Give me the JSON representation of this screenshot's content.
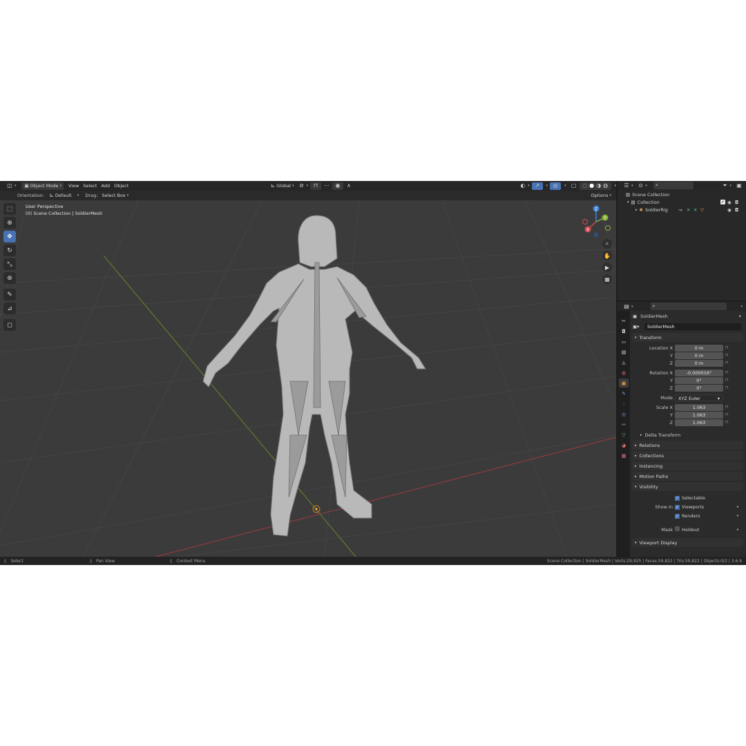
{
  "header": {
    "mode": "Object Mode",
    "menus": [
      "View",
      "Select",
      "Add",
      "Object"
    ],
    "transform_orientation": "Global"
  },
  "toolbar2": {
    "orientation_label": "Orientation:",
    "orientation_value": "Default",
    "drag_label": "Drag:",
    "drag_value": "Select Box",
    "options_label": "Options"
  },
  "viewport": {
    "perspective": "User Perspective",
    "context": "(0) Scene Collection | SoldierMesh",
    "gizmo_axes": [
      "Z",
      "Y",
      "X"
    ],
    "axis_colors": {
      "x": "#d34b53",
      "y": "#8bb33a",
      "z": "#3f86d6"
    }
  },
  "tools": [
    "select-box",
    "cursor",
    "move",
    "rotate",
    "scale",
    "transform",
    "annotate",
    "measure",
    "add-cube"
  ],
  "outliner": {
    "search_placeholder": "",
    "items": [
      {
        "label": "Scene Collection"
      },
      {
        "label": "Collection"
      },
      {
        "label": "SoldierRig"
      }
    ]
  },
  "properties": {
    "search_placeholder": "",
    "object_name": "SoldierMesh",
    "object_name_field": "SoldierMesh",
    "transform_title": "Transform",
    "location_label": "Location X",
    "location": [
      "0 m",
      "0 m",
      "0 m"
    ],
    "rotation_label": "Rotation X",
    "rotation": [
      "-0.000016°",
      "0°",
      "0°"
    ],
    "y_label": "Y",
    "z_label": "Z",
    "mode_label": "Mode",
    "mode_value": "XYZ Euler",
    "scale_label": "Scale X",
    "scale": [
      "1.063",
      "1.063",
      "1.063"
    ],
    "delta_transform": "Delta Transform",
    "panels": [
      "Relations",
      "Collections",
      "Instancing",
      "Motion Paths"
    ],
    "visibility_title": "Visibility",
    "selectable": "Selectable",
    "show_in_label": "Show In",
    "viewports": "Viewports",
    "renders": "Renders",
    "mask_label": "Mask",
    "holdout": "Holdout",
    "viewport_display": "Viewport Display"
  },
  "statusbar": {
    "select": "Select",
    "pan_view": "Pan View",
    "context_menu": "Context Menu",
    "stats": "Scene Collection | SoldierMesh | Verts:29,925 | Faces:59,822 | Tris:59,822 | Objects:0/2 | 3.6.9"
  }
}
